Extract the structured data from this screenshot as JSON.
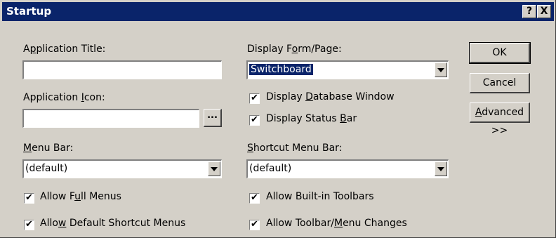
{
  "dialog": {
    "title": "Startup",
    "help_btn": "?",
    "close_btn": "X"
  },
  "left": {
    "app_title_label": "Application Title:",
    "app_title_value": "",
    "app_icon_label": "Application Icon:",
    "app_icon_value": "",
    "browse_label": "...",
    "menu_bar_label": "Menu Bar:",
    "menu_bar_value": "(default)",
    "allow_full_menus": {
      "label": "Allow Full Menus",
      "checked": true
    },
    "allow_default_shortcut": {
      "label": "Allow Default Shortcut Menus",
      "checked": true
    }
  },
  "middle": {
    "display_form_label": "Display Form/Page:",
    "display_form_value": "Switchboard",
    "display_db_window": {
      "label": "Display Database Window",
      "checked": true
    },
    "display_status_bar": {
      "label": "Display Status Bar",
      "checked": true
    },
    "shortcut_menu_label": "Shortcut Menu Bar:",
    "shortcut_menu_value": "(default)",
    "allow_builtin_toolbars": {
      "label": "Allow Built-in Toolbars",
      "checked": true
    },
    "allow_toolbar_changes": {
      "label": "Allow Toolbar/Menu Changes",
      "checked": true
    }
  },
  "buttons": {
    "ok": "OK",
    "cancel": "Cancel",
    "advanced": "Advanced >>"
  },
  "check_glyph": "✔"
}
